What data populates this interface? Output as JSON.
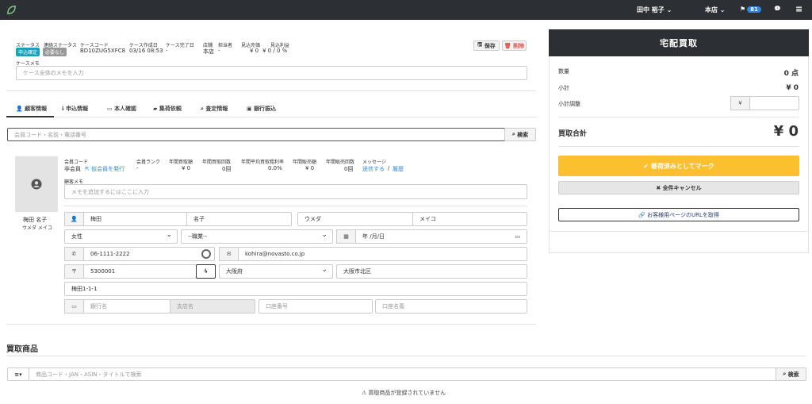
{
  "nav": {
    "user": "田中 裕子",
    "store": "本店",
    "notifications": "81",
    "user_caret": "⌄",
    "store_caret": "⌄",
    "flag_icon": "⚑",
    "chat_icon": "💬",
    "menu_icon": "≡"
  },
  "case": {
    "labels": {
      "status": "ステータス",
      "contact_status": "連絡ステータス",
      "case_code": "ケースコード",
      "created": "ケース作成日",
      "completed": "ケース完了日",
      "store": "店舗",
      "staff": "担当者",
      "est_sales": "見込売価",
      "est_profit": "見込利益",
      "memo": "ケースメモ"
    },
    "status_tag": "申込確定",
    "contact_tag": "必要なし",
    "case_code": "BD10ZUG5XFC8",
    "created": "03/16 08:53",
    "completed": "-",
    "store": "本店",
    "staff": "-",
    "est_sales": "¥ 0",
    "est_profit": "¥ 0 / 0 %",
    "save_label": "保存",
    "delete_label": "削除",
    "memo_placeholder": "ケース全体のメモを入力"
  },
  "tabs": [
    "顧客情報",
    "申込情報",
    "本人確認",
    "集荷依頼",
    "査定情報",
    "銀行振込"
  ],
  "customer_search": {
    "placeholder": "会員コード・名前・電話番号",
    "button": "検索"
  },
  "customer": {
    "name": "梅田 名子",
    "kana": "ウメダ メイコ",
    "labels": {
      "member_code": "会員コード",
      "rank": "会員ランク",
      "yearly_total": "年間買取額",
      "yearly_count": "年間買取回数",
      "avg_rate": "年間平均買取粗利率",
      "sales_total": "年間販売額",
      "sales_count": "年間販売回数",
      "message": "メッセージ",
      "memo": "顧客メモ"
    },
    "member_code": "非会員",
    "issue_link": "仮会員を発行",
    "rank": "-",
    "yearly_total": "¥ 0",
    "yearly_count": "0回",
    "avg_rate": "0.0%",
    "sales_total": "¥ 0",
    "sales_count": "0回",
    "message_send": "送信する",
    "message_sep": "/",
    "message_history": "履歴",
    "memo_placeholder": "メモを追加するにはここに入力",
    "last_name": "梅田",
    "first_name": "名子",
    "last_kana": "ウメダ",
    "first_kana": "メイコ",
    "gender": "女性",
    "job": "--職業--",
    "birthday": "年 /月/日",
    "phone": "06-1111-2222",
    "email": "kohira@novasto.co.jp",
    "postal": "5300001",
    "prefecture": "大阪府",
    "city": "大阪市北区",
    "address": "梅田1-1-1",
    "bank_placeholder": "銀行名",
    "branch_placeholder": "支店名",
    "account_no_placeholder": "口座番号",
    "account_name_placeholder": "口座名義"
  },
  "products": {
    "title": "買取商品",
    "filter_label": "≡▾",
    "search_placeholder": "商品コード・JAN・ASIN・タイトルで検索",
    "search_button": "検索",
    "empty_message": "買取商品が登録されていません"
  },
  "summary": {
    "title": "宅配買取",
    "qty_label": "数量",
    "qty_value": "0 点",
    "subtotal_label": "小計",
    "subtotal_value": "¥ 0",
    "adjust_label": "小計調整",
    "adjust_prefix": "¥",
    "total_label": "買取合計",
    "total_value": "¥ 0",
    "mark_label": "着荷済みとしてマーク",
    "cancel_label": "全件キャンセル",
    "url_label": "お客様用ページのURLを取得"
  },
  "colors": {
    "nav": "#2c2f33",
    "status_tag": "#17a2b8",
    "contact_tag": "#999999",
    "accent_yellow": "#fbc02d",
    "link": "#2e86de",
    "delete": "#d9534f"
  }
}
